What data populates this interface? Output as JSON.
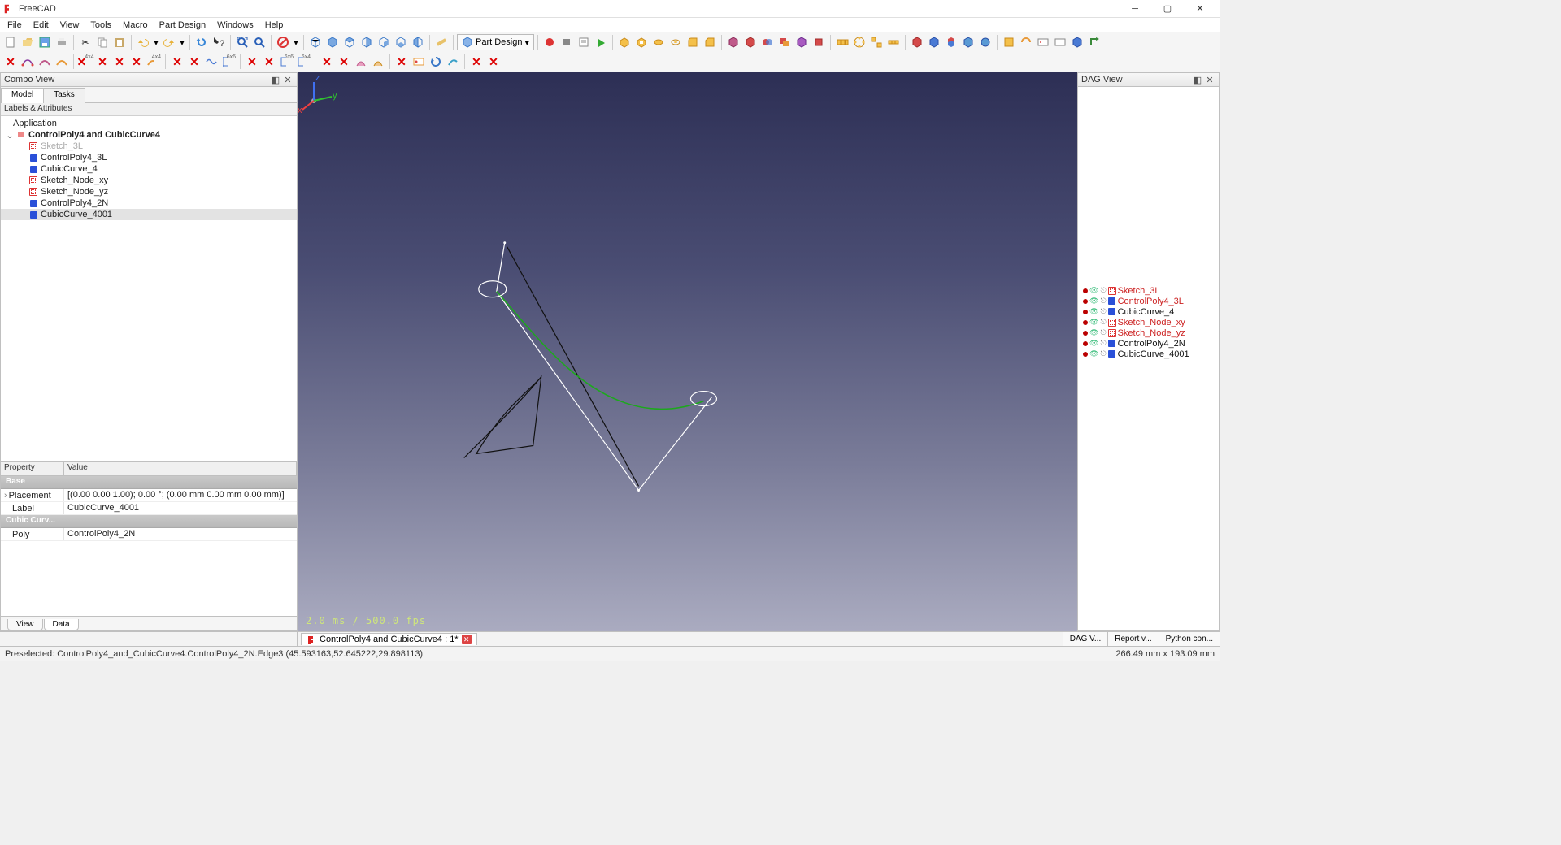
{
  "app": {
    "title": "FreeCAD"
  },
  "menu": [
    "File",
    "Edit",
    "View",
    "Tools",
    "Macro",
    "Part Design",
    "Windows",
    "Help"
  ],
  "workbench_selector": "Part Design",
  "combo": {
    "title": "Combo View",
    "tabs": [
      "Model",
      "Tasks"
    ],
    "active_tab": 0,
    "subheader": "Labels & Attributes",
    "tree_root": "Application",
    "doc_name": "ControlPoly4 and CubicCurve4",
    "items": [
      {
        "icon": "sketch",
        "label": "Sketch_3L",
        "dim": true
      },
      {
        "icon": "cube",
        "label": "ControlPoly4_3L"
      },
      {
        "icon": "cube",
        "label": "CubicCurve_4"
      },
      {
        "icon": "sketch",
        "label": "Sketch_Node_xy"
      },
      {
        "icon": "sketch",
        "label": "Sketch_Node_yz"
      },
      {
        "icon": "cube",
        "label": "ControlPoly4_2N"
      },
      {
        "icon": "cube",
        "label": "CubicCurve_4001",
        "sel": true
      }
    ],
    "bottom_tabs": [
      "View",
      "Data"
    ],
    "bottom_active": 1
  },
  "props": {
    "headers": [
      "Property",
      "Value"
    ],
    "group1": "Base",
    "rows1": [
      {
        "k": "Placement",
        "v": "[(0.00 0.00 1.00); 0.00 °; (0.00 mm  0.00 mm  0.00 mm)]",
        "expandable": true
      },
      {
        "k": "Label",
        "v": "CubicCurve_4001"
      }
    ],
    "group2": "Cubic Curv...",
    "rows2": [
      {
        "k": "Poly",
        "v": "ControlPoly4_2N"
      }
    ]
  },
  "dag": {
    "title": "DAG View",
    "rows": [
      {
        "icon": "sketch",
        "label": "Sketch_3L",
        "red": true
      },
      {
        "icon": "cube",
        "label": "ControlPoly4_3L",
        "red": true
      },
      {
        "icon": "cube",
        "label": "CubicCurve_4",
        "red": false
      },
      {
        "icon": "sketch",
        "label": "Sketch_Node_xy",
        "red": true
      },
      {
        "icon": "sketch",
        "label": "Sketch_Node_yz",
        "red": true
      },
      {
        "icon": "cube",
        "label": "ControlPoly4_2N",
        "red": false
      },
      {
        "icon": "cube",
        "label": "CubicCurve_4001",
        "red": false
      }
    ]
  },
  "viewport": {
    "fps": "2.0 ms / 500.0 fps",
    "axes": {
      "x": "x",
      "y": "y",
      "z": "z"
    }
  },
  "tabstrip": {
    "doc": "ControlPoly4 and CubicCurve4 : 1*",
    "right": [
      "DAG V...",
      "Report v...",
      "Python con..."
    ]
  },
  "status": {
    "left": "Preselected: ControlPoly4_and_CubicCurve4.ControlPoly4_2N.Edge3 (45.593163,52.645222,29.898113)",
    "right": "266.49 mm x 193.09 mm"
  }
}
